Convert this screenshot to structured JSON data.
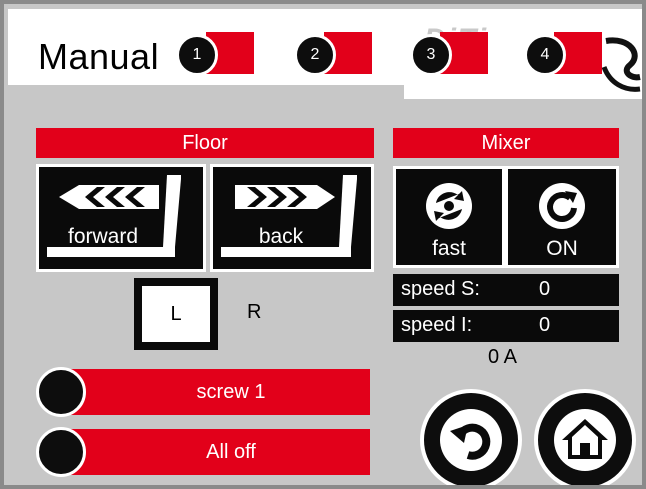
{
  "header": {
    "title": "Manual",
    "title_suffix_visible": "a",
    "logo_text": "DiTi",
    "tabs": [
      {
        "number": "1"
      },
      {
        "number": "2"
      },
      {
        "number": "3"
      },
      {
        "number": "4"
      }
    ]
  },
  "floor": {
    "title": "Floor",
    "forward_label": "forward",
    "back_label": "back",
    "toggle_left": "L",
    "toggle_right": "R"
  },
  "mixer": {
    "title": "Mixer",
    "fast_label": "fast",
    "on_label": "ON",
    "speed_s_label": "speed S:",
    "speed_s_value": "0",
    "speed_i_label": "speed I:",
    "speed_i_value": "0",
    "current": "0 A"
  },
  "actions": {
    "screw_label": "screw 1",
    "all_off_label": "All off"
  },
  "icons": {
    "forward": "arrow-left-chevrons-icon",
    "back": "arrow-right-chevrons-icon",
    "fast": "mixer-swirl-icon",
    "on": "rotate-clockwise-icon",
    "undo": "undo-icon",
    "home": "home-icon"
  },
  "colors": {
    "accent": "#e2001a",
    "panel": "#c7c7c7",
    "button": "#0a0a0a"
  }
}
